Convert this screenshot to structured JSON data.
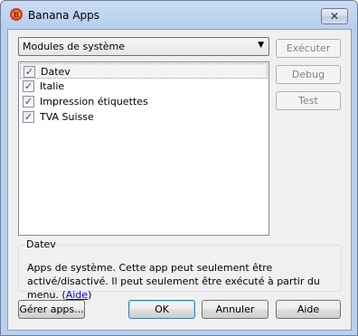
{
  "window": {
    "title": "Banana Apps"
  },
  "toolbar": {
    "module_select": "Modules de système",
    "execute_label": "Exécuter",
    "debug_label": "Debug",
    "test_label": "Test"
  },
  "apps": [
    {
      "label": "Datev",
      "checked": true,
      "selected": true
    },
    {
      "label": "Italie",
      "checked": true,
      "selected": false
    },
    {
      "label": "Impression étiquettes",
      "checked": true,
      "selected": false
    },
    {
      "label": "TVA Suisse",
      "checked": true,
      "selected": false
    }
  ],
  "details": {
    "title": "Datev",
    "text_before": "Apps de système. Cette app peut seulement être activé/disactivé. Il peut seulement être exécuté à partir du menu. (",
    "link_label": "Aide",
    "text_after": ")"
  },
  "footer": {
    "manage_label": "Gérer apps...",
    "ok_label": "OK",
    "cancel_label": "Annuler",
    "help_label": "Aide"
  },
  "icons": {
    "app_icon": "banana-apps-icon",
    "close": "close-icon",
    "dropdown": "chevron-down-icon",
    "checkbox": "checkmark-icon"
  }
}
